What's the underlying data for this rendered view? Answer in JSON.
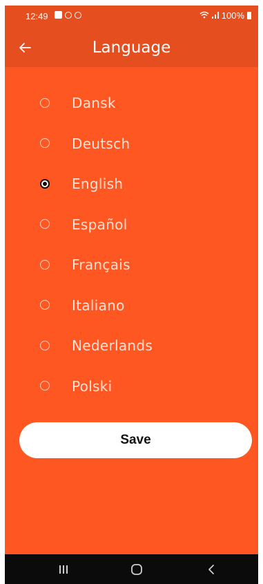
{
  "status_bar": {
    "time": "12:49",
    "battery": "100%",
    "icons": [
      "gallery-icon",
      "app-notification-icon",
      "settings-notification-icon",
      "wifi-icon",
      "signal-icon",
      "battery-icon"
    ]
  },
  "app_bar": {
    "title": "Language",
    "back_icon": "arrow-left-icon"
  },
  "languages": [
    {
      "label": "Dansk",
      "selected": false
    },
    {
      "label": "Deutsch",
      "selected": false
    },
    {
      "label": "English",
      "selected": true
    },
    {
      "label": "Español",
      "selected": false
    },
    {
      "label": "Français",
      "selected": false
    },
    {
      "label": "Italiano",
      "selected": false
    },
    {
      "label": "Nederlands",
      "selected": false
    },
    {
      "label": "Polski",
      "selected": false
    }
  ],
  "save_button": {
    "label": "Save"
  },
  "nav_bar": {
    "icons": [
      "recent-apps-icon",
      "home-icon",
      "back-icon"
    ]
  },
  "colors": {
    "background": "#fe5722",
    "app_bar": "#e54e1f",
    "button": "#ffffff",
    "nav_bar": "#0b0b0b"
  }
}
